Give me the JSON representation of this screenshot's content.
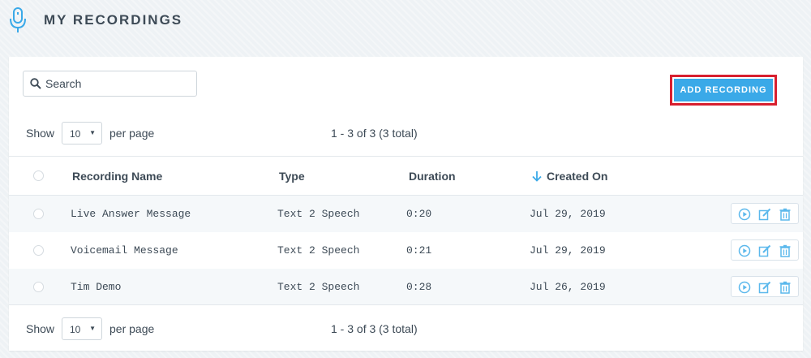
{
  "header": {
    "title": "MY RECORDINGS",
    "icon": "microphone-icon",
    "accent_color": "#3aa9e8"
  },
  "search": {
    "placeholder": "Search",
    "value": ""
  },
  "toolbar": {
    "add_label": "ADD RECORDING"
  },
  "pagination": {
    "show_label": "Show",
    "per_page_value": "10",
    "per_page_label": "per page",
    "range_text": "1 - 3 of 3 (3 total)"
  },
  "table": {
    "columns": [
      "Recording Name",
      "Type",
      "Duration",
      "Created On"
    ],
    "sort_column": "Created On",
    "sort_direction": "desc",
    "rows": [
      {
        "name": "Live Answer Message",
        "type": "Text 2 Speech",
        "duration": "0:20",
        "created": "Jul 29, 2019"
      },
      {
        "name": "Voicemail Message",
        "type": "Text 2 Speech",
        "duration": "0:21",
        "created": "Jul 29, 2019"
      },
      {
        "name": "Tim Demo",
        "type": "Text 2 Speech",
        "duration": "0:28",
        "created": "Jul 26, 2019"
      }
    ],
    "row_actions": [
      "play-icon",
      "edit-icon",
      "trash-icon"
    ]
  }
}
